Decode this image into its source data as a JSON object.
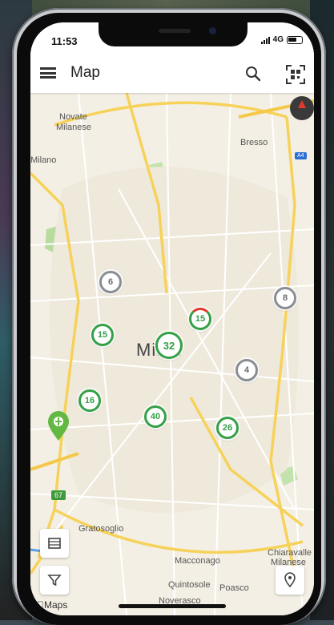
{
  "status_bar": {
    "time": "11:53",
    "network": "4G"
  },
  "app_bar": {
    "title": "Map"
  },
  "map": {
    "city_label": "Milan",
    "labels": [
      {
        "text": "Novate",
        "name": "label-novate"
      },
      {
        "text": "Milanese",
        "name": "label-milanese-north"
      },
      {
        "text": "Bresso",
        "name": "label-bresso"
      },
      {
        "text": "Milano",
        "name": "label-milano"
      },
      {
        "text": "Gratosoglio",
        "name": "label-gratosoglio"
      },
      {
        "text": "Macconago",
        "name": "label-macconago"
      },
      {
        "text": "Chiaravalle",
        "name": "label-chiaravalle"
      },
      {
        "text": "Milanese",
        "name": "label-milanese-south"
      },
      {
        "text": "Quintosole",
        "name": "label-quintosole"
      },
      {
        "text": "Noverasco",
        "name": "label-noverasco"
      },
      {
        "text": "Poasco",
        "name": "label-poasco"
      }
    ],
    "clusters": [
      {
        "count": "6",
        "color": "grey"
      },
      {
        "count": "8",
        "color": "green"
      },
      {
        "count": "15",
        "color": "green"
      },
      {
        "count": "15",
        "color": "green"
      },
      {
        "count": "32",
        "color": "green"
      },
      {
        "count": "4",
        "color": "grey"
      },
      {
        "count": "16",
        "color": "green"
      },
      {
        "count": "40",
        "color": "green"
      },
      {
        "count": "26",
        "color": "green"
      }
    ],
    "road_badges": {
      "a": "67"
    },
    "attribution": "Maps"
  },
  "colors": {
    "cluster_green": "#35a047",
    "cluster_grey": "#8a8e93",
    "road_yellow": "#f6d25a"
  },
  "icons": [
    "menu-icon",
    "search-icon",
    "qr-scan-icon",
    "compass-icon",
    "layers-icon",
    "filter-icon",
    "location-pin-icon",
    "map-pin-marker-icon"
  ]
}
